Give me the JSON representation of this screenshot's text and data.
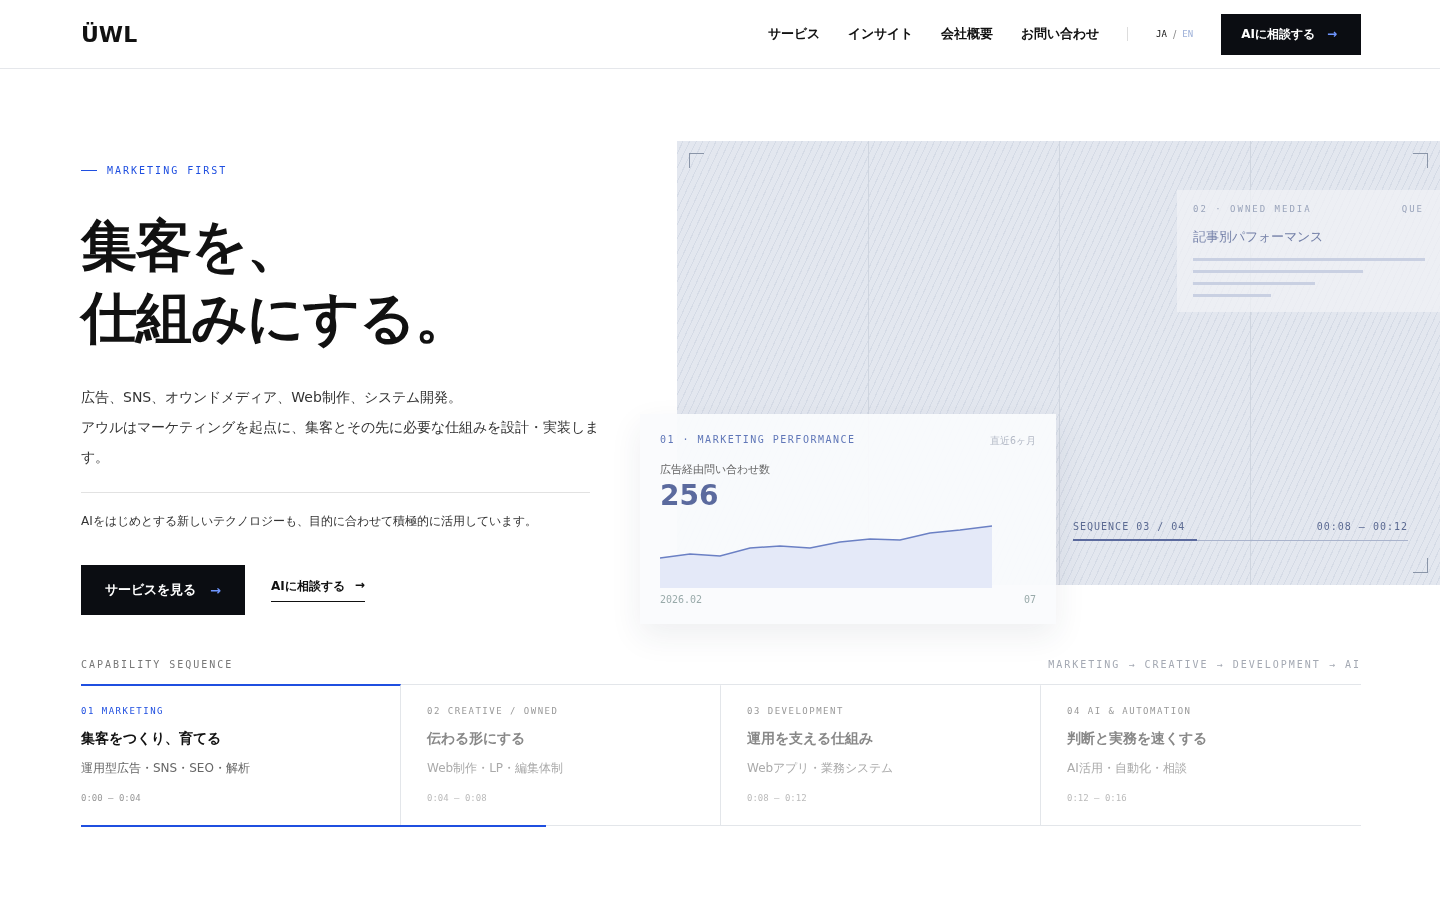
{
  "header": {
    "logo": "ÜWL",
    "nav": [
      {
        "label": "サービス"
      },
      {
        "label": "インサイト"
      },
      {
        "label": "会社概要"
      },
      {
        "label": "お問い合わせ"
      }
    ],
    "languages": [
      {
        "label": "JA",
        "selected": true
      },
      {
        "label": "EN",
        "selected": false
      }
    ],
    "language_separator": "/",
    "cta": {
      "label": "AIに相談する",
      "icon": "→"
    }
  },
  "hero": {
    "eyebrow": "MARKETING FIRST",
    "headline": [
      "集客を、",
      "仕組みにする。"
    ],
    "lead": [
      "広告、SNS、オウンドメディア、Web制作、システム開発。",
      "アウルはマーケティングを起点に、集客とその先に必要な仕組みを設計・実装します。"
    ],
    "note": "AIをはじめとする新しいテクノロジーも、目的に合わせて積極的に活用しています。",
    "primary_button": {
      "label": "サービスを見る",
      "icon": "→"
    },
    "secondary_link": {
      "label": "AIに相談する",
      "icon": "→"
    }
  },
  "visual": {
    "back_card": {
      "eyebrow": "02 · OWNED MEDIA",
      "side": "QUE",
      "title": "記事別パフォーマンス"
    },
    "sequence": {
      "label": "SEQUENCE 03 / 04",
      "time": "00:08 — 00:12",
      "level": 0.37
    },
    "front_card": {
      "eyebrow": "01 · MARKETING PERFORMANCE",
      "period": "直近6ヶ月",
      "metric_label": "広告経由問い合わせ数",
      "metric_value": "256",
      "x_start": "2026.02",
      "x_end": "07"
    }
  },
  "capabilities": {
    "title": "CAPABILITY SEQUENCE",
    "flow": "MARKETING → CREATIVE → DEVELOPMENT → AI",
    "items": [
      {
        "index": "01 MARKETING",
        "title": "集客をつくり、育てる",
        "detail": "運用型広告・SNS・SEO・解析",
        "time": "0:00 — 0:04",
        "selected": true
      },
      {
        "index": "02 CREATIVE / OWNED",
        "title": "伝わる形にする",
        "detail": "Web制作・LP・編集体制",
        "time": "0:04 — 0:08",
        "selected": false
      },
      {
        "index": "03 DEVELOPMENT",
        "title": "運用を支える仕組み",
        "detail": "Webアプリ・業務システム",
        "time": "0:08 — 0:12",
        "selected": false
      },
      {
        "index": "04 AI & AUTOMATION",
        "title": "判断と実務を速くする",
        "detail": "AI活用・自動化・相談",
        "time": "0:12 — 0:16",
        "selected": false
      }
    ],
    "progress": {
      "level": 0.363
    }
  }
}
